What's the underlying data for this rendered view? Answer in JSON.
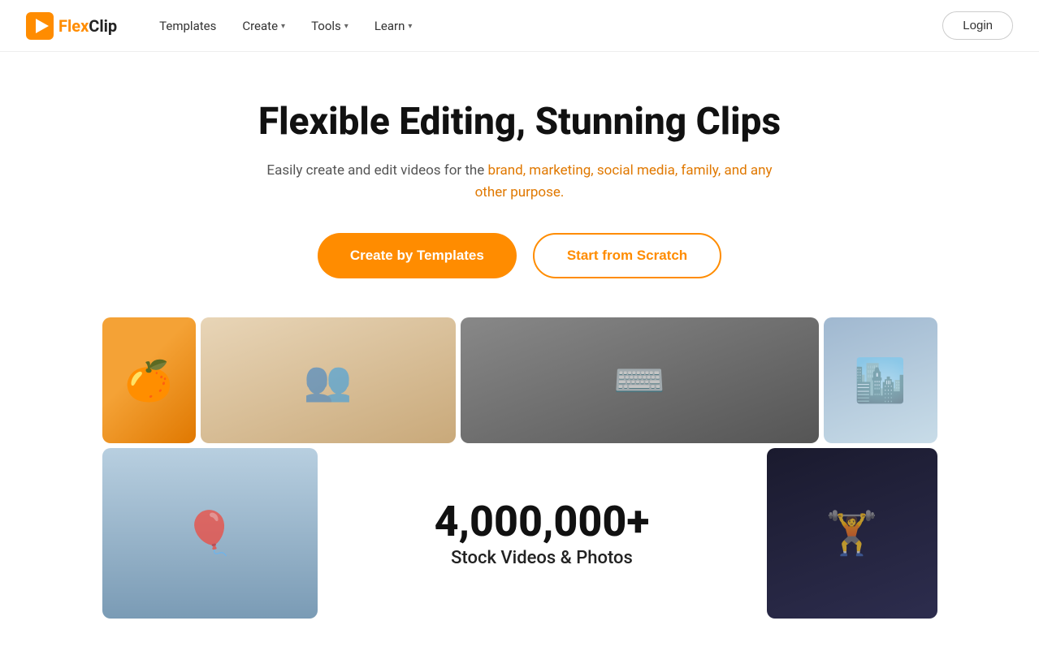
{
  "navbar": {
    "logo_text": "FlexClip",
    "nav_items": [
      {
        "label": "Templates",
        "has_dropdown": false
      },
      {
        "label": "Create",
        "has_dropdown": true
      },
      {
        "label": "Tools",
        "has_dropdown": true
      },
      {
        "label": "Learn",
        "has_dropdown": true
      }
    ],
    "login_label": "Login"
  },
  "hero": {
    "title": "Flexible Editing, Stunning Clips",
    "subtitle": "Easily create and edit videos for the brand, marketing, social media, family, and any other purpose.",
    "cta_primary": "Create by Templates",
    "cta_secondary": "Start from Scratch"
  },
  "stats": {
    "number": "4,000,000+",
    "label": "Stock Videos & Photos"
  },
  "icons": {
    "chevron": "▾"
  }
}
